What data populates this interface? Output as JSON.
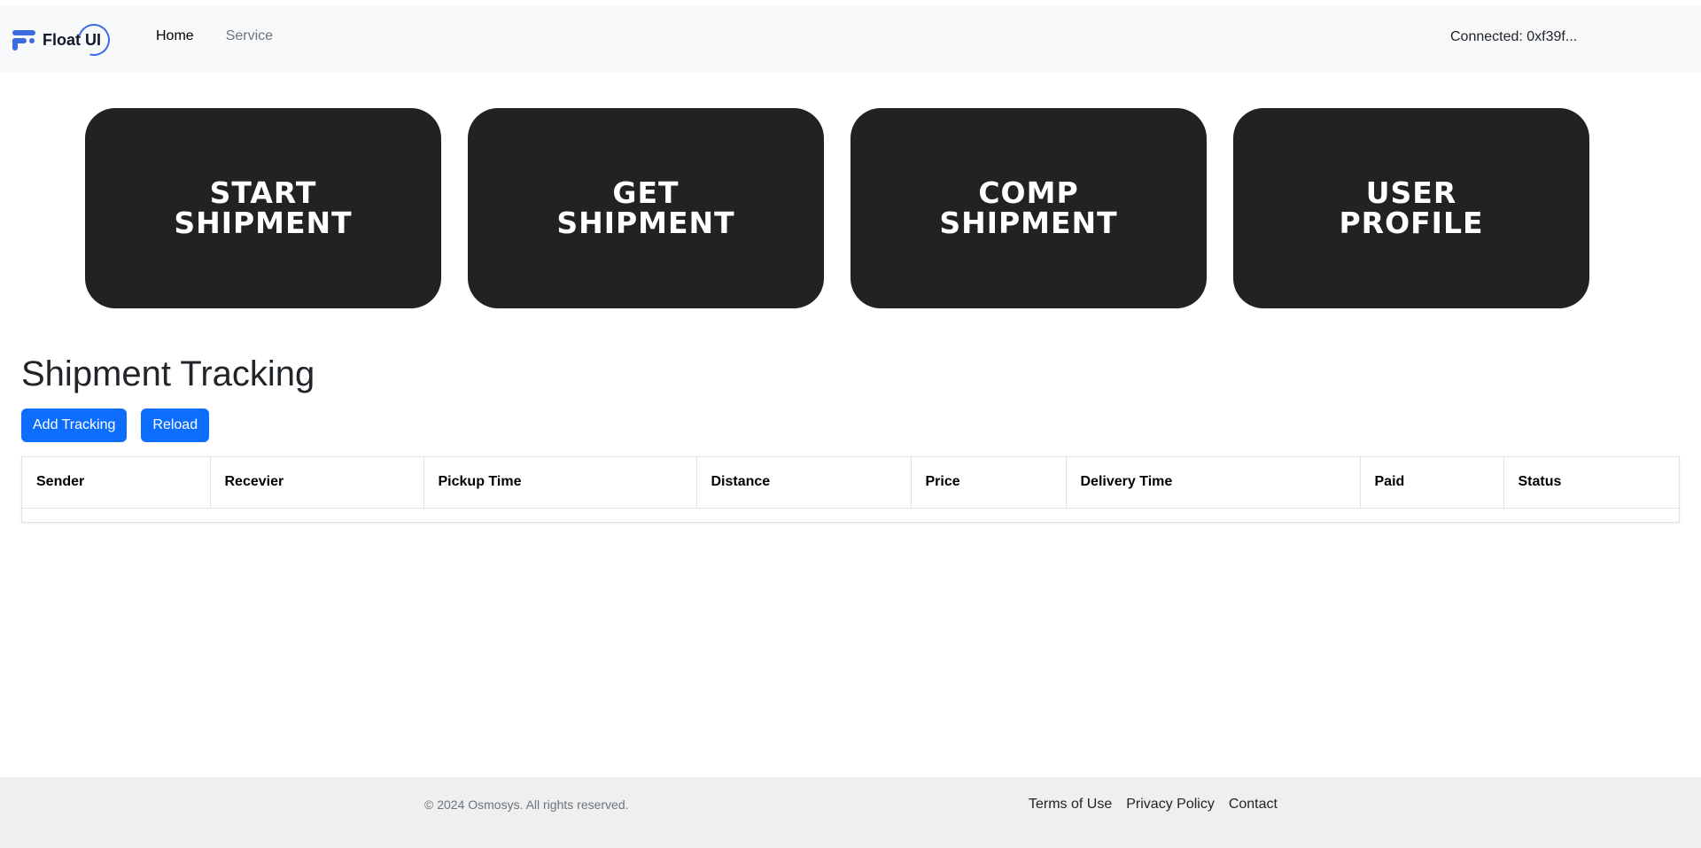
{
  "header": {
    "brand": "Float UI",
    "nav": [
      {
        "label": "Home"
      },
      {
        "label": "Service"
      }
    ],
    "connected": "Connected: 0xf39f..."
  },
  "cards": [
    {
      "line1": "START",
      "line2": "SHIPMENT"
    },
    {
      "line1": "GET",
      "line2": "SHIPMENT"
    },
    {
      "line1": "COMP",
      "line2": "SHIPMENT"
    },
    {
      "line1": "USER",
      "line2": "PROFILE"
    }
  ],
  "main": {
    "title": "Shipment Tracking",
    "add_button": "Add Tracking",
    "reload_button": "Reload",
    "table": {
      "columns": [
        "Sender",
        "Recevier",
        "Pickup Time",
        "Distance",
        "Price",
        "Delivery Time",
        "Paid",
        "Status"
      ],
      "rows": []
    }
  },
  "footer": {
    "copyright": "© 2024 Osmosys. All rights reserved.",
    "links": [
      "Terms of Use",
      "Privacy Policy",
      "Contact"
    ]
  },
  "colors": {
    "primary": "#0d6efd",
    "card_bg": "#222222",
    "brand_blue": "#3b6be0",
    "navbar_bg": "#f8f9fa",
    "footer_bg": "#efefef"
  }
}
